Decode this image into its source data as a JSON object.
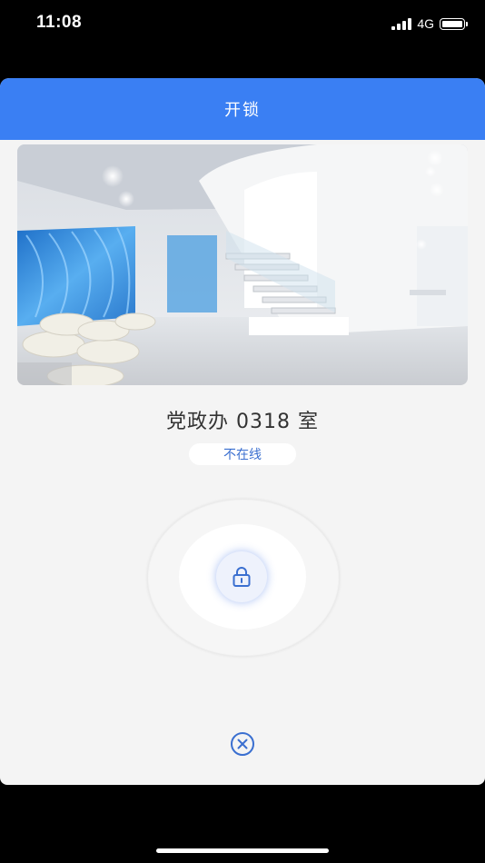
{
  "status_bar": {
    "time": "11:08",
    "network": "4G",
    "battery_level": 1.0,
    "signal_bars": 4
  },
  "dialog": {
    "title": "开锁",
    "header_color": "#3a7ff3",
    "room_name": "党政办 0318 室",
    "connection_status": "不在线"
  },
  "icons": {
    "lock": "lock-icon",
    "close": "close-circle-icon"
  },
  "colors": {
    "accent": "#3a7ff3",
    "status_text": "#3a6fd0"
  }
}
